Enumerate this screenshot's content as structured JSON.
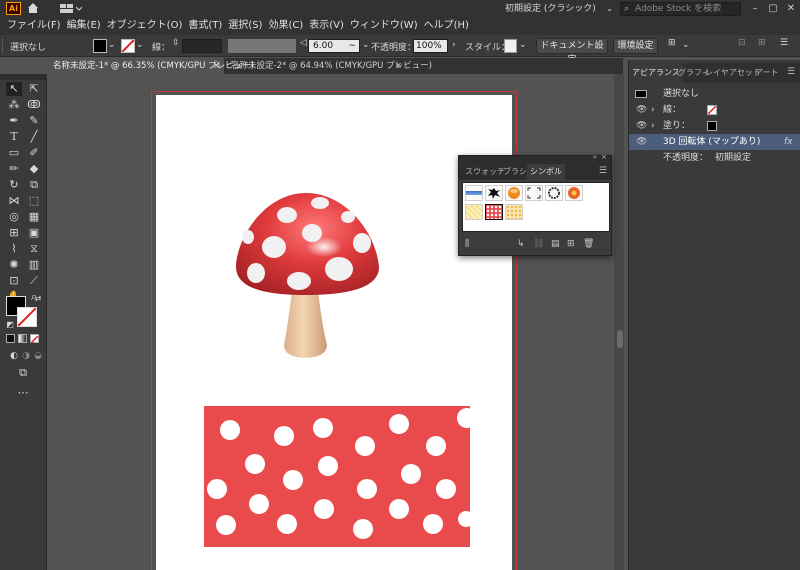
{
  "titlebar": {
    "app_icon": "Ai",
    "workspace": "初期設定 (クラシック)",
    "search_placeholder": "Adobe Stock を検索"
  },
  "menu": [
    "ファイル(F)",
    "編集(E)",
    "オブジェクト(O)",
    "書式(T)",
    "選択(S)",
    "効果(C)",
    "表示(V)",
    "ウィンドウ(W)",
    "ヘルプ(H)"
  ],
  "control": {
    "selection": "選択なし",
    "stroke_label": "線：",
    "stroke_weight": "6.00",
    "opacity_label": "不透明度：",
    "opacity": "100%",
    "style_label": "スタイル：",
    "doc_setup": "ドキュメント設定",
    "prefs": "環境設定"
  },
  "tabs": [
    {
      "label": "名称未設定-1* @ 66.35% (CMYK/GPU プレビュー)",
      "close": "×"
    },
    {
      "label": "名称未設定-2* @ 64.94% (CMYK/GPU プレビュー)",
      "close": "×"
    }
  ],
  "symbols_panel": {
    "tabs": [
      "スウォッチ",
      "ブラシ",
      "シンボル"
    ]
  },
  "right_panel": {
    "tabs": [
      "アピアランス",
      "グラフィ",
      "レイヤ",
      "アセット",
      "アート"
    ],
    "header": "選択なし",
    "rows": [
      {
        "label": "線："
      },
      {
        "label": "塗り："
      },
      {
        "label": "3D 回転体 (マップあり)",
        "fx": "fx"
      },
      {
        "label": "不透明度：",
        "value": "初期設定"
      }
    ]
  },
  "colors": {
    "mushroom_red": "#e03b3d",
    "pattern_red": "#e94b4d",
    "stem": "#ecc8a1",
    "ui_dark": "#323232",
    "ui_panel": "#3a3a3a",
    "selection_blue": "#4b5d7a"
  }
}
